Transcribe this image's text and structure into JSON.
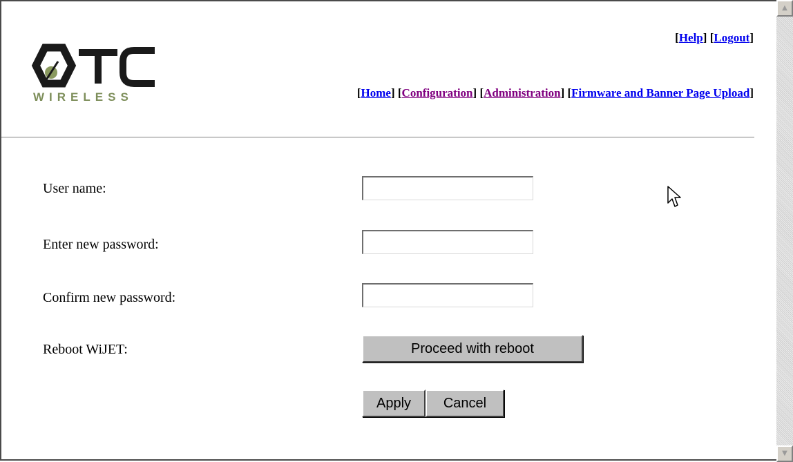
{
  "logo": {
    "wordmark_text": "WIRELESS",
    "brand_colors": {
      "dark": "#1a1a1a",
      "olive": "#7d8e5a"
    }
  },
  "top_links": [
    {
      "label": "Help"
    },
    {
      "label": "Logout"
    }
  ],
  "main_nav": [
    {
      "label": "Home",
      "visited": false
    },
    {
      "label": "Configuration",
      "visited": true
    },
    {
      "label": "Administration",
      "visited": true
    },
    {
      "label": "Firmware and Banner Page Upload",
      "visited": false
    }
  ],
  "form": {
    "username_label": "User name:",
    "username_value": "",
    "new_password_label": "Enter new password:",
    "new_password_value": "",
    "confirm_password_label": "Confirm new password:",
    "confirm_password_value": "",
    "reboot_label": "Reboot WiJET:",
    "reboot_button": "Proceed with reboot",
    "apply_button": "Apply",
    "cancel_button": "Cancel"
  },
  "colors": {
    "link": "#0000ee",
    "visited_link": "#800080",
    "button_face": "#c0c0c0"
  }
}
